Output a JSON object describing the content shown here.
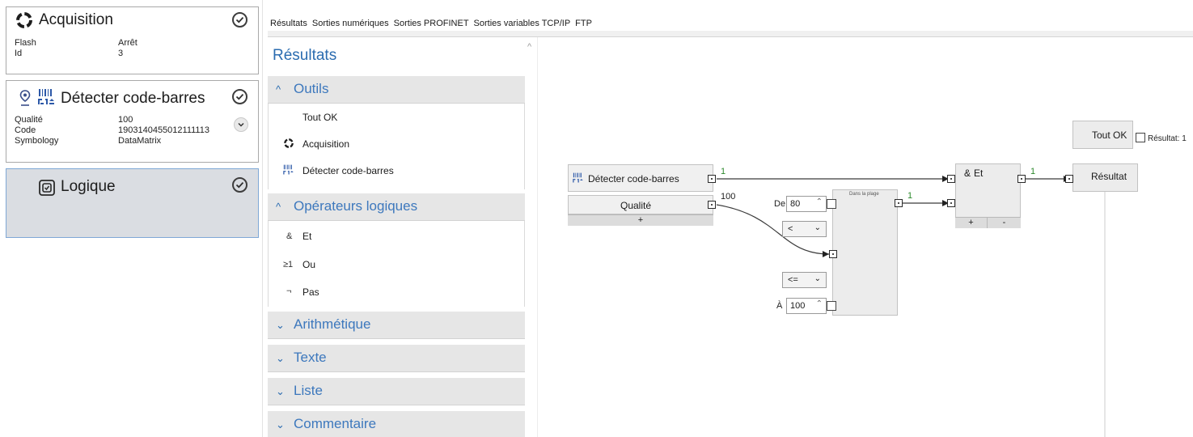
{
  "steps": {
    "acquisition": {
      "title": "Acquisition",
      "icon": "acquisition-ring-icon",
      "props": [
        {
          "key": "Flash",
          "value": "Arrêt"
        },
        {
          "key": "Id",
          "value": "3"
        }
      ]
    },
    "barcode": {
      "title": "Détecter code-barres",
      "icon": "barcode-icon",
      "props": [
        {
          "key": "Qualité",
          "value": "100"
        },
        {
          "key": "Code",
          "value": "1903140455012111113"
        },
        {
          "key": "Symbology",
          "value": "DataMatrix"
        }
      ]
    },
    "logic": {
      "title": "Logique",
      "icon": "logic-chip-icon"
    }
  },
  "tabs": [
    "Résultats",
    "Sorties numériques",
    "Sorties PROFINET",
    "Sorties variables TCP/IP",
    "FTP"
  ],
  "toolbox": {
    "title": "Résultats",
    "sections": {
      "outils": {
        "label": "Outils",
        "expanded": true
      },
      "logiques": {
        "label": "Opérateurs logiques",
        "expanded": true
      },
      "arith": {
        "label": "Arithmétique",
        "expanded": false
      },
      "texte": {
        "label": "Texte",
        "expanded": false
      },
      "liste": {
        "label": "Liste",
        "expanded": false
      },
      "commentaire": {
        "label": "Commentaire",
        "expanded": false
      }
    },
    "tools": {
      "tout_ok": "Tout OK",
      "acquisition": "Acquisition",
      "barcode": "Détecter code-barres"
    },
    "operators": [
      {
        "symbol": "&",
        "label": "Et"
      },
      {
        "symbol": "≥1",
        "label": "Ou"
      },
      {
        "symbol": "¬",
        "label": "Pas"
      }
    ]
  },
  "canvas": {
    "barcode_node": {
      "title": "Détecter code-barres",
      "output": "Qualité",
      "add": "+",
      "out_value_1": "1",
      "out_value_qual": "100"
    },
    "range_node": {
      "title": "Dans la plage",
      "from_label": "De",
      "from_value": "80",
      "op_low": "<",
      "op_high": "<=",
      "to_label": "À",
      "to_value": "100",
      "out_value": "1"
    },
    "and_node": {
      "symbol": "&",
      "title": "Et",
      "add": "+",
      "remove": "-",
      "out_value": "1"
    },
    "result_node": {
      "title": "Résultat"
    },
    "tout_ok_node": {
      "title": "Tout OK",
      "result_label": "Résultat: 1"
    }
  },
  "colors": {
    "accent_blue": "#2b6cb0",
    "section_label": "#3d78bd",
    "selected_card": "#dadde2",
    "wire_value_green": "#2d8a2d"
  }
}
